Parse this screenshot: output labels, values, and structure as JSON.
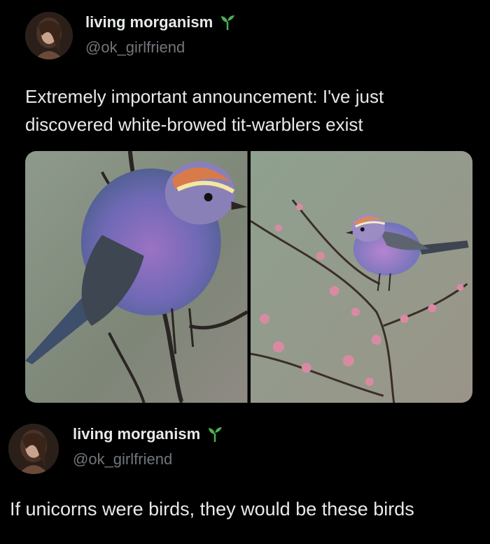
{
  "post1": {
    "author_name": "living morganism",
    "author_handle": "@ok_girlfriend",
    "text": "Extremely important announcement: I've just discovered white-browed tit-warblers exist",
    "badge_icon": "sprout-icon",
    "media": [
      {
        "icon": "bird-photo",
        "alt": ""
      },
      {
        "icon": "bird-photo",
        "alt": ""
      }
    ]
  },
  "post2": {
    "author_name": "living morganism",
    "author_handle": "@ok_girlfriend",
    "text": "If unicorns were birds, they would be these birds",
    "badge_icon": "sprout-icon"
  },
  "colors": {
    "background": "#000000",
    "text": "#e7e9ea",
    "secondary_text": "#71767b",
    "sprout": "#4caf50"
  }
}
